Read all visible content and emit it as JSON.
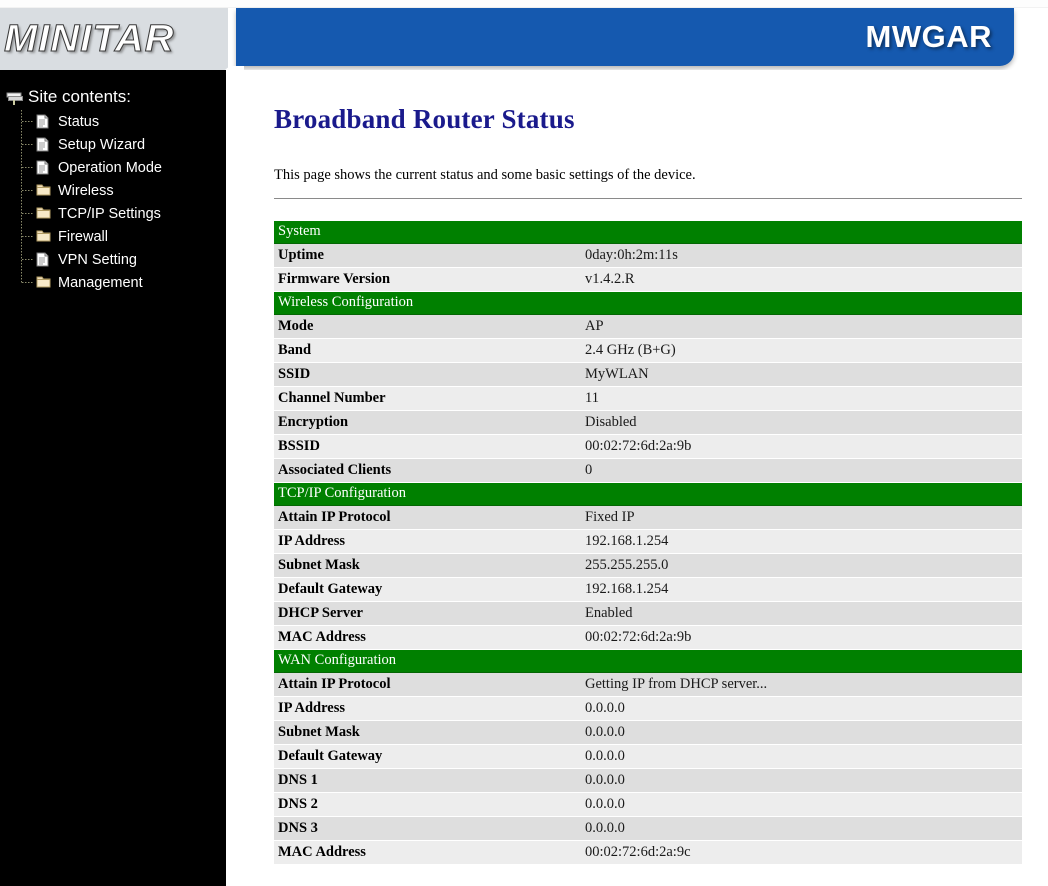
{
  "brand": {
    "logo_text": "MINITAR",
    "model_text": "MWGAR"
  },
  "sidebar": {
    "root_label": "Site contents:",
    "root_icon": "book-stack-icon",
    "items": [
      {
        "label": "Status",
        "icon": "document-icon"
      },
      {
        "label": "Setup Wizard",
        "icon": "document-icon"
      },
      {
        "label": "Operation Mode",
        "icon": "document-icon"
      },
      {
        "label": "Wireless",
        "icon": "folder-icon"
      },
      {
        "label": "TCP/IP Settings",
        "icon": "folder-icon"
      },
      {
        "label": "Firewall",
        "icon": "folder-icon"
      },
      {
        "label": "VPN Setting",
        "icon": "document-icon"
      },
      {
        "label": "Management",
        "icon": "folder-icon"
      }
    ]
  },
  "main": {
    "title": "Broadband Router Status",
    "description": "This page shows the current status and some basic settings of the device.",
    "sections": [
      {
        "title": "System",
        "rows": [
          {
            "label": "Uptime",
            "value": "0day:0h:2m:11s"
          },
          {
            "label": "Firmware Version",
            "value": "v1.4.2.R"
          }
        ]
      },
      {
        "title": "Wireless Configuration",
        "rows": [
          {
            "label": "Mode",
            "value": "AP"
          },
          {
            "label": "Band",
            "value": "2.4 GHz (B+G)"
          },
          {
            "label": "SSID",
            "value": "MyWLAN"
          },
          {
            "label": "Channel Number",
            "value": "11"
          },
          {
            "label": "Encryption",
            "value": "Disabled"
          },
          {
            "label": "BSSID",
            "value": "00:02:72:6d:2a:9b"
          },
          {
            "label": "Associated Clients",
            "value": "0"
          }
        ]
      },
      {
        "title": "TCP/IP Configuration",
        "rows": [
          {
            "label": "Attain IP Protocol",
            "value": "Fixed IP"
          },
          {
            "label": "IP Address",
            "value": "192.168.1.254"
          },
          {
            "label": "Subnet Mask",
            "value": "255.255.255.0"
          },
          {
            "label": "Default Gateway",
            "value": "192.168.1.254"
          },
          {
            "label": "DHCP Server",
            "value": "Enabled"
          },
          {
            "label": "MAC Address",
            "value": "00:02:72:6d:2a:9b"
          }
        ]
      },
      {
        "title": "WAN Configuration",
        "rows": [
          {
            "label": "Attain IP Protocol",
            "value": "Getting IP from DHCP server..."
          },
          {
            "label": "IP Address",
            "value": "0.0.0.0"
          },
          {
            "label": "Subnet Mask",
            "value": "0.0.0.0"
          },
          {
            "label": "Default Gateway",
            "value": "0.0.0.0"
          },
          {
            "label": "DNS 1",
            "value": "0.0.0.0"
          },
          {
            "label": "DNS 2",
            "value": "0.0.0.0"
          },
          {
            "label": "DNS 3",
            "value": "0.0.0.0"
          },
          {
            "label": "MAC Address",
            "value": "00:02:72:6d:2a:9c"
          }
        ]
      }
    ]
  },
  "colors": {
    "banner_blue": "#1559af",
    "section_green": "#008000",
    "title_navy": "#1a1a8c",
    "sidebar_black": "#000000",
    "logo_plate_gray": "#d9dde1",
    "row_odd": "#dedede",
    "row_even": "#ededed"
  }
}
